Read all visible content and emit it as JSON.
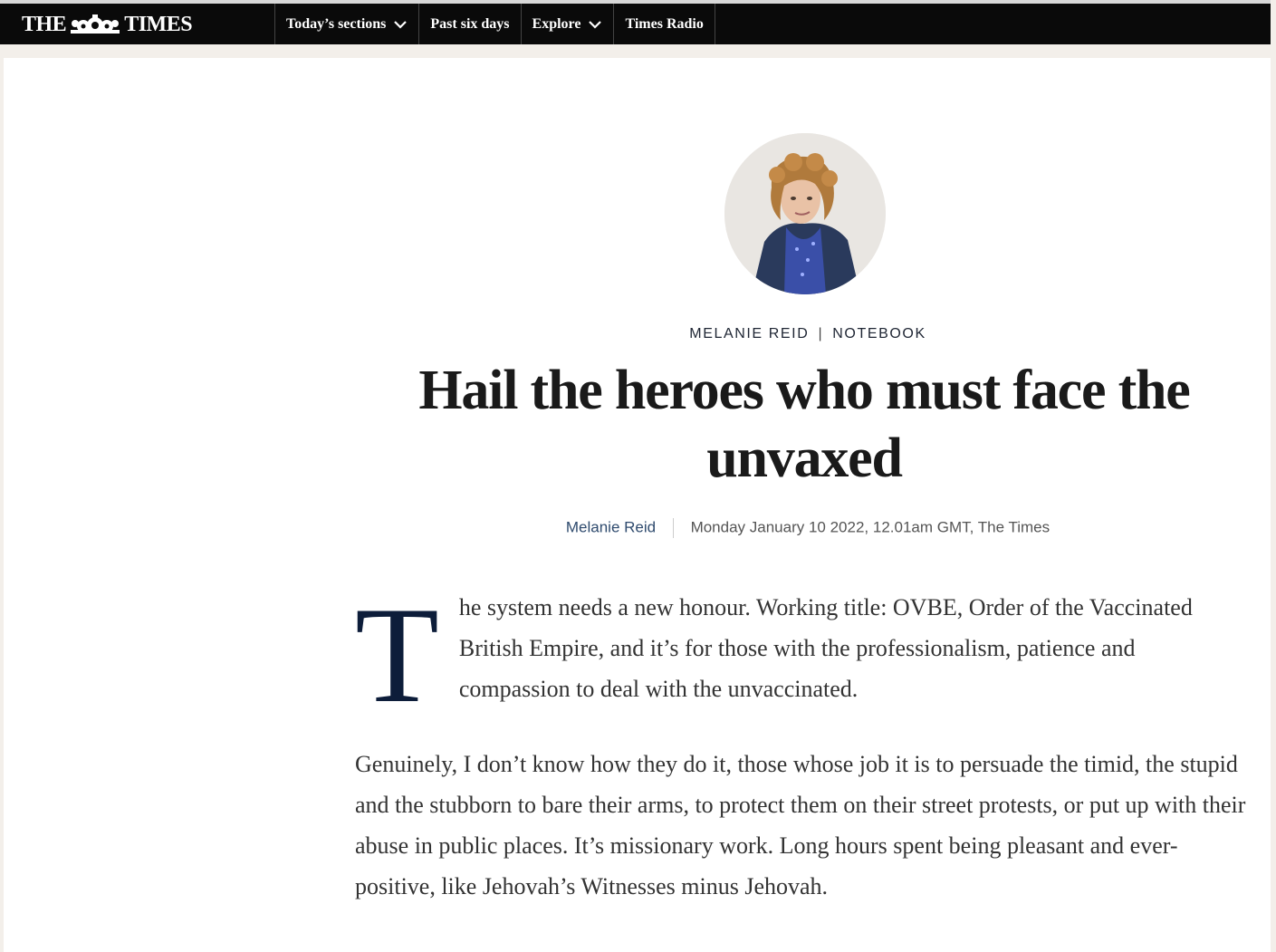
{
  "brand": {
    "logo_left": "THE",
    "logo_right": "TIMES",
    "logo_icon": "crest-icon"
  },
  "nav": {
    "items": [
      {
        "label": "Today’s sections",
        "has_dropdown": true
      },
      {
        "label": "Past six days",
        "has_dropdown": false
      },
      {
        "label": "Explore",
        "has_dropdown": true
      },
      {
        "label": "Times Radio",
        "has_dropdown": false
      }
    ]
  },
  "article": {
    "author_photo": "author-avatar",
    "kicker_author": "MELANIE REID",
    "kicker_sep": "|",
    "kicker_section": "NOTEBOOK",
    "headline": "Hail the heroes who must face the unvaxed",
    "byline_author": "Melanie Reid",
    "byline_meta": "Monday January 10 2022, 12.01am GMT, The Times",
    "dropcap": "T",
    "paragraph_1": "he system needs a new honour. Working title: OVBE, Order of the Vaccinated British Empire, and it’s for those with the professionalism, patience and compassion to deal with the unvaccinated.",
    "paragraph_2": "Genuinely, I don’t know how they do it, those whose job it is to persuade the timid, the stupid and the stubborn to bare their arms, to protect them on their street protests, or put up with their abuse in public places. It’s missionary work. Long hours spent being pleasant and ever-positive, like Jehovah’s Witnesses minus Jehovah."
  },
  "colors": {
    "nav_bg": "#0a0a0a",
    "page_bg": "#f3efea",
    "dropcap": "#0d1d3a",
    "author_link": "#2f4b6e"
  }
}
